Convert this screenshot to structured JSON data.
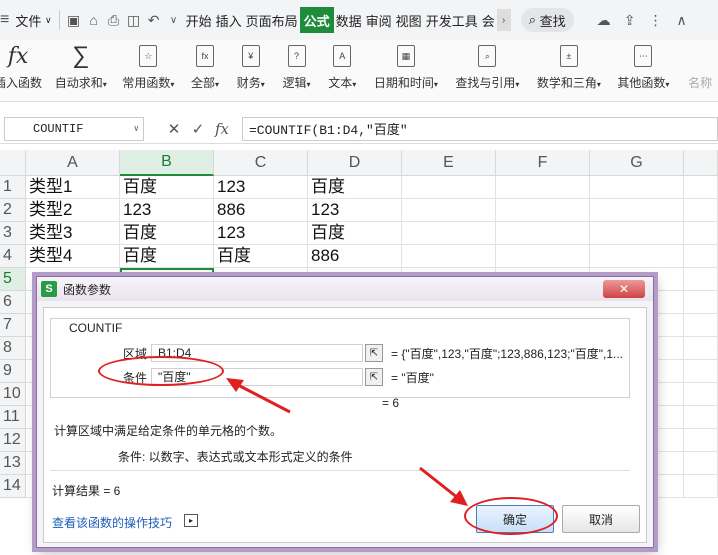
{
  "menubar": {
    "file": "文件",
    "tabs": [
      "开始",
      "插入",
      "页面布局",
      "公式",
      "数据",
      "审阅",
      "视图",
      "开发工具",
      "会"
    ],
    "active_tab": "公式",
    "search": "查找"
  },
  "ribbon": {
    "items": [
      "插入函数",
      "自动求和",
      "常用函数",
      "全部",
      "财务",
      "逻辑",
      "文本",
      "日期和时间",
      "查找与引用",
      "数学和三角",
      "其他函数",
      "名称"
    ],
    "fx_symbol": "fx",
    "sum_symbol": "∑"
  },
  "formula_bar": {
    "name_box": "COUNTIF",
    "formula": "=COUNTIF(B1:D4,\"百度\""
  },
  "grid": {
    "columns": [
      "A",
      "B",
      "C",
      "D",
      "E",
      "F",
      "G"
    ],
    "rows": [
      [
        "类型1",
        "百度",
        "123",
        "百度"
      ],
      [
        "类型2",
        "123",
        "886",
        "123"
      ],
      [
        "类型3",
        "百度",
        "123",
        "百度"
      ],
      [
        "类型4",
        "百度",
        "百度",
        "886"
      ]
    ],
    "row_numbers": [
      "1",
      "2",
      "3",
      "4",
      "5",
      "6",
      "7",
      "8",
      "9",
      "10",
      "11",
      "12",
      "13",
      "14"
    ]
  },
  "dialog": {
    "title": "函数参数",
    "function_name": "COUNTIF",
    "args": [
      {
        "label": "区域",
        "input": "B1:D4",
        "value": "= {\"百度\",123,\"百度\";123,886,123;\"百度\",1..."
      },
      {
        "label": "条件",
        "input": "\"百度\"",
        "value": "= \"百度\""
      }
    ],
    "result_eq": "= 6",
    "description": "计算区域中满足给定条件的单元格的个数。",
    "arg_desc": "条件:  以数字、表达式或文本形式定义的条件",
    "calc_result": "计算结果 = 6",
    "help_link": "查看该函数的操作技巧",
    "ok": "确定",
    "cancel": "取消"
  },
  "colors": {
    "accent": "#1f8c3b",
    "annotation": "#e02020"
  }
}
